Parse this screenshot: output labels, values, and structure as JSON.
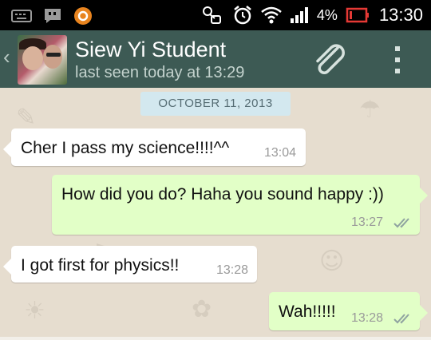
{
  "status_bar": {
    "battery_percent": "4%",
    "time": "13:30",
    "icons": [
      "keyboard-icon",
      "chat-notification-icon",
      "app-notification-icon",
      "voicemail-icon",
      "alarm-icon",
      "wifi-icon",
      "signal-icon",
      "battery-low-icon"
    ]
  },
  "header": {
    "contact_name": "Siew Yi Student",
    "last_seen": "last seen today at 13:29",
    "back_icon": "chevron-left-icon",
    "attach_icon": "paperclip-icon",
    "menu_icon": "overflow-menu-icon",
    "color": "#3d5a54"
  },
  "chat": {
    "date_chip": "OCTOBER 11, 2013",
    "messages": [
      {
        "direction": "incoming",
        "text": "Cher I pass my science!!!!^^",
        "time": "13:04"
      },
      {
        "direction": "outgoing",
        "text": "How did you do? Haha you sound happy :))",
        "time": "13:27",
        "status": "read-double-tick"
      },
      {
        "direction": "incoming",
        "text": "I got first for physics!!",
        "time": "13:28"
      },
      {
        "direction": "outgoing",
        "text": "Wah!!!!!",
        "time": "13:28",
        "status": "read-double-tick"
      }
    ],
    "colors": {
      "incoming": "#ffffff",
      "outgoing": "#e2ffc7",
      "background": "#e6ddcf"
    }
  }
}
